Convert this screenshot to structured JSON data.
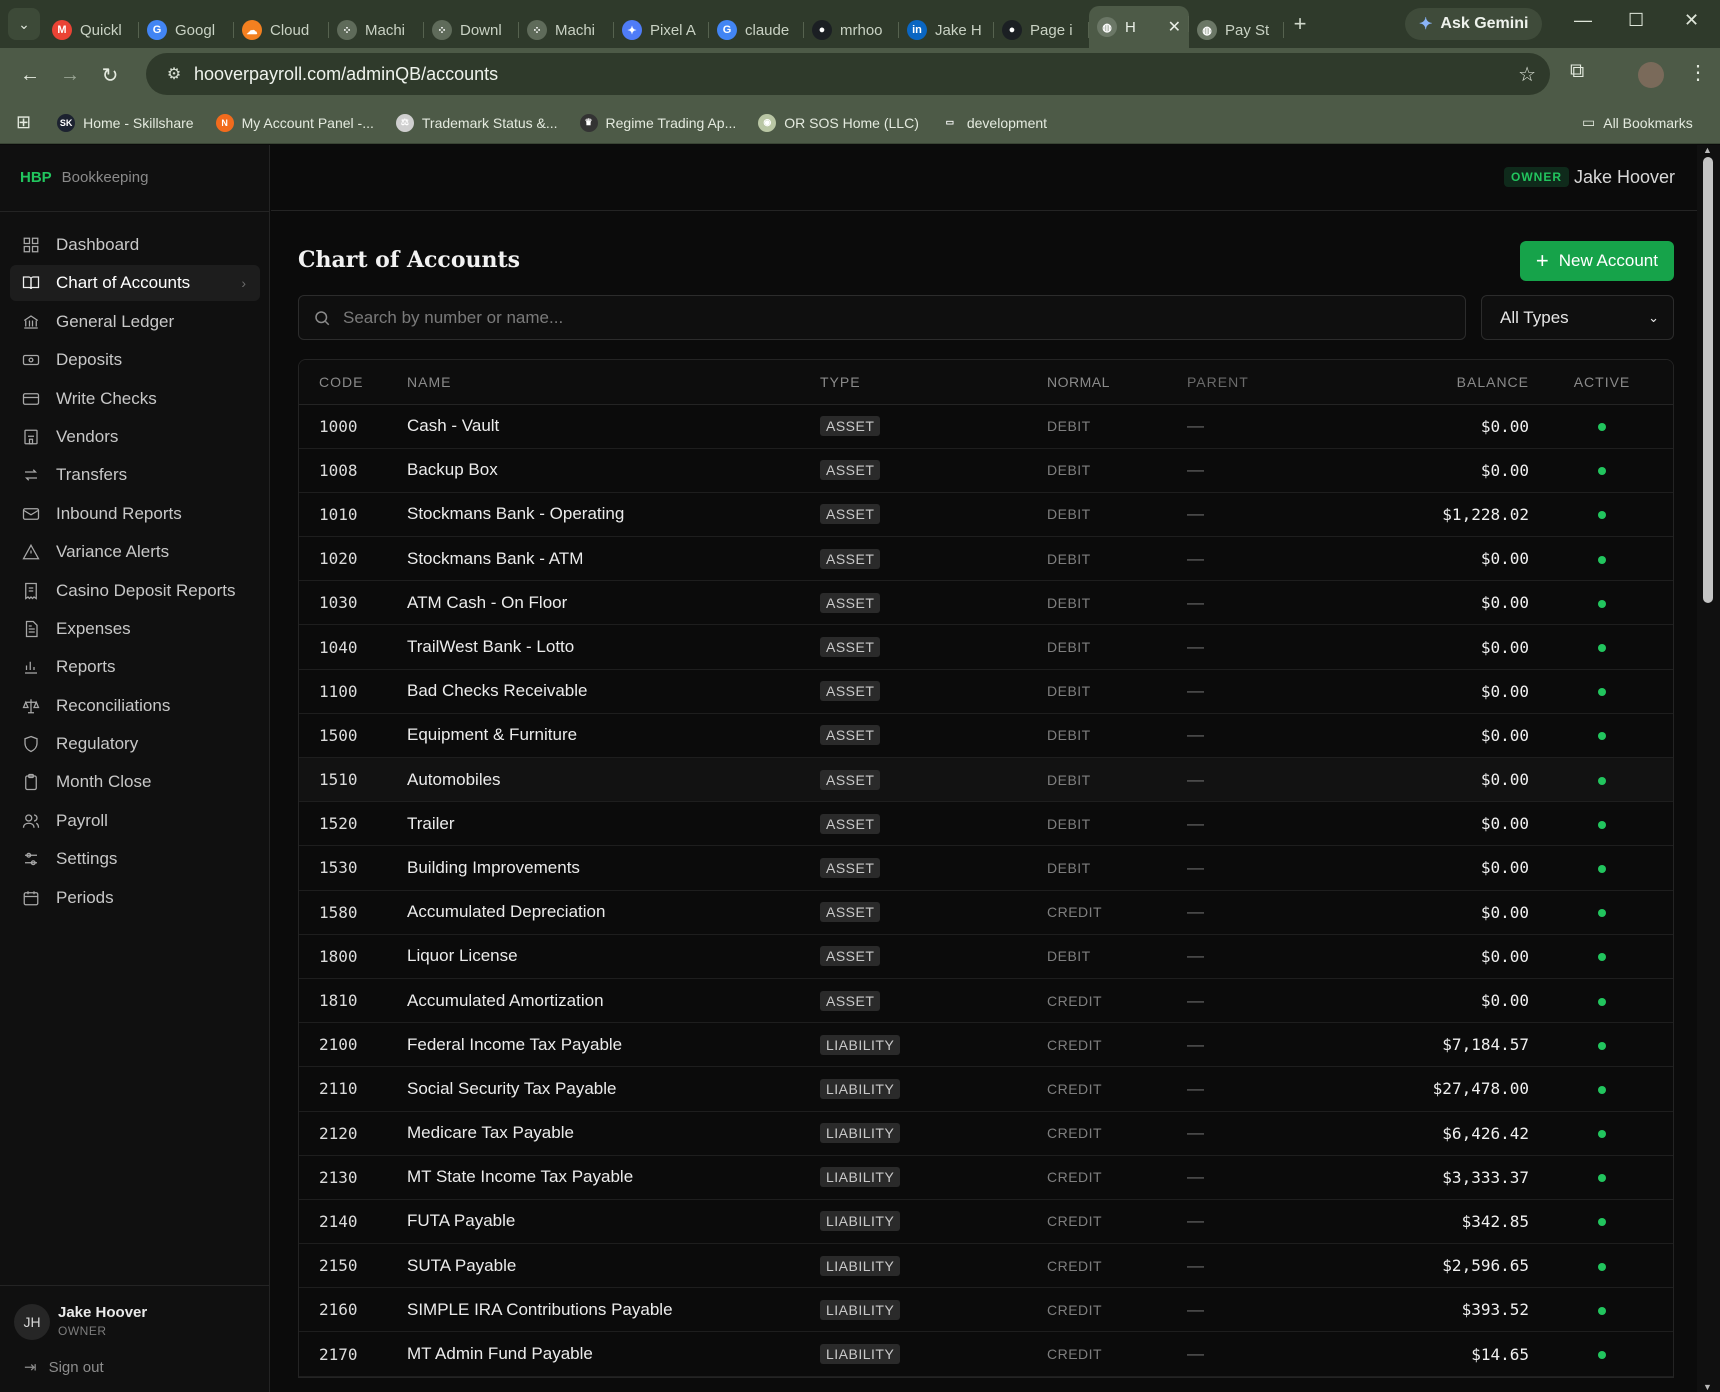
{
  "browser": {
    "tabs": [
      {
        "label": "Quickl",
        "icon": "gmail-icon",
        "color": "#ea4335",
        "glyph": "M"
      },
      {
        "label": "Googl",
        "icon": "google-icon",
        "color": "#4285f4",
        "glyph": "G"
      },
      {
        "label": "Cloud",
        "icon": "cloudflare-icon",
        "color": "#f38020",
        "glyph": "☁"
      },
      {
        "label": "Machi",
        "icon": "dots-icon",
        "color": "#5f6b5a",
        "glyph": "⁘"
      },
      {
        "label": "Downl",
        "icon": "dots-icon",
        "color": "#5f6b5a",
        "glyph": "⁘"
      },
      {
        "label": "Machi",
        "icon": "dots-icon",
        "color": "#5f6b5a",
        "glyph": "⁘"
      },
      {
        "label": "Pixel A",
        "icon": "gemini-icon",
        "color": "#4f7cf7",
        "glyph": "✦"
      },
      {
        "label": "claude",
        "icon": "google-icon",
        "color": "#4285f4",
        "glyph": "G"
      },
      {
        "label": "mrhoo",
        "icon": "github-icon",
        "color": "#1b1f23",
        "glyph": "●"
      },
      {
        "label": "Jake H",
        "icon": "linkedin-icon",
        "color": "#0a66c2",
        "glyph": "in"
      },
      {
        "label": "Page i",
        "icon": "github-icon",
        "color": "#1b1f23",
        "glyph": "●"
      },
      {
        "label": "H",
        "icon": "globe-icon",
        "color": "#6b7766",
        "glyph": "◍",
        "active": true
      },
      {
        "label": "Pay St",
        "icon": "globe-icon",
        "color": "#6b7766",
        "glyph": "◍"
      }
    ],
    "ask_gemini": "Ask Gemini",
    "url": "hooverpayroll.com/adminQB/accounts",
    "bookmarks": [
      {
        "label": "Home - Skillshare",
        "color": "#1c2230",
        "glyph": "SK"
      },
      {
        "label": "My Account Panel -...",
        "color": "#f26b1d",
        "glyph": "N"
      },
      {
        "label": "Trademark Status &...",
        "color": "#cfcfcf",
        "glyph": "⚖"
      },
      {
        "label": "Regime Trading Ap...",
        "color": "#333",
        "glyph": "♛"
      },
      {
        "label": "OR SOS Home (LLC)",
        "color": "#b9c6a4",
        "glyph": "◉"
      },
      {
        "label": "development",
        "color": "transparent",
        "glyph": "▭"
      }
    ],
    "all_bookmarks": "All Bookmarks"
  },
  "app": {
    "brand_logo": "HBP",
    "brand_name": "Bookkeeping",
    "owner_badge": "OWNER",
    "top_user": "Jake Hoover",
    "accent": "#22c55e"
  },
  "sidebar": {
    "items": [
      {
        "label": "Dashboard",
        "icon": "grid-icon"
      },
      {
        "label": "Chart of Accounts",
        "icon": "book-icon",
        "active": true
      },
      {
        "label": "General Ledger",
        "icon": "bank-icon"
      },
      {
        "label": "Deposits",
        "icon": "cash-icon"
      },
      {
        "label": "Write Checks",
        "icon": "card-icon"
      },
      {
        "label": "Vendors",
        "icon": "store-icon"
      },
      {
        "label": "Transfers",
        "icon": "transfer-icon"
      },
      {
        "label": "Inbound Reports",
        "icon": "mail-icon"
      },
      {
        "label": "Variance Alerts",
        "icon": "warning-icon"
      },
      {
        "label": "Casino Deposit Reports",
        "icon": "receipt-icon"
      },
      {
        "label": "Expenses",
        "icon": "document-icon"
      },
      {
        "label": "Reports",
        "icon": "bar-chart-icon"
      },
      {
        "label": "Reconciliations",
        "icon": "scale-icon"
      },
      {
        "label": "Regulatory",
        "icon": "shield-icon"
      },
      {
        "label": "Month Close",
        "icon": "clipboard-icon"
      },
      {
        "label": "Payroll",
        "icon": "users-icon"
      },
      {
        "label": "Settings",
        "icon": "sliders-icon"
      },
      {
        "label": "Periods",
        "icon": "calendar-icon"
      }
    ],
    "user": {
      "initials": "JH",
      "name": "Jake Hoover",
      "role": "OWNER"
    },
    "sign_out": "Sign out"
  },
  "main": {
    "title": "Chart of Accounts",
    "new_button": "New Account",
    "search_placeholder": "Search by number or name...",
    "type_filter": "All Types"
  },
  "table": {
    "columns": {
      "code": "CODE",
      "name": "NAME",
      "type": "TYPE",
      "normal": "NORMAL",
      "parent": "PARENT",
      "balance": "BALANCE",
      "active": "ACTIVE"
    },
    "rows": [
      {
        "code": "1000",
        "name": "Cash - Vault",
        "type": "ASSET",
        "normal": "DEBIT",
        "parent": "—",
        "balance": "$0.00"
      },
      {
        "code": "1008",
        "name": "Backup Box",
        "type": "ASSET",
        "normal": "DEBIT",
        "parent": "—",
        "balance": "$0.00"
      },
      {
        "code": "1010",
        "name": "Stockmans Bank - Operating",
        "type": "ASSET",
        "normal": "DEBIT",
        "parent": "—",
        "balance": "$1,228.02"
      },
      {
        "code": "1020",
        "name": "Stockmans Bank - ATM",
        "type": "ASSET",
        "normal": "DEBIT",
        "parent": "—",
        "balance": "$0.00"
      },
      {
        "code": "1030",
        "name": "ATM Cash - On Floor",
        "type": "ASSET",
        "normal": "DEBIT",
        "parent": "—",
        "balance": "$0.00"
      },
      {
        "code": "1040",
        "name": "TrailWest Bank - Lotto",
        "type": "ASSET",
        "normal": "DEBIT",
        "parent": "—",
        "balance": "$0.00"
      },
      {
        "code": "1100",
        "name": "Bad Checks Receivable",
        "type": "ASSET",
        "normal": "DEBIT",
        "parent": "—",
        "balance": "$0.00"
      },
      {
        "code": "1500",
        "name": "Equipment & Furniture",
        "type": "ASSET",
        "normal": "DEBIT",
        "parent": "—",
        "balance": "$0.00"
      },
      {
        "code": "1510",
        "name": "Automobiles",
        "type": "ASSET",
        "normal": "DEBIT",
        "parent": "—",
        "balance": "$0.00",
        "highlight": true
      },
      {
        "code": "1520",
        "name": "Trailer",
        "type": "ASSET",
        "normal": "DEBIT",
        "parent": "—",
        "balance": "$0.00"
      },
      {
        "code": "1530",
        "name": "Building Improvements",
        "type": "ASSET",
        "normal": "DEBIT",
        "parent": "—",
        "balance": "$0.00"
      },
      {
        "code": "1580",
        "name": "Accumulated Depreciation",
        "type": "ASSET",
        "normal": "CREDIT",
        "parent": "—",
        "balance": "$0.00"
      },
      {
        "code": "1800",
        "name": "Liquor License",
        "type": "ASSET",
        "normal": "DEBIT",
        "parent": "—",
        "balance": "$0.00"
      },
      {
        "code": "1810",
        "name": "Accumulated Amortization",
        "type": "ASSET",
        "normal": "CREDIT",
        "parent": "—",
        "balance": "$0.00"
      },
      {
        "code": "2100",
        "name": "Federal Income Tax Payable",
        "type": "LIABILITY",
        "normal": "CREDIT",
        "parent": "—",
        "balance": "$7,184.57"
      },
      {
        "code": "2110",
        "name": "Social Security Tax Payable",
        "type": "LIABILITY",
        "normal": "CREDIT",
        "parent": "—",
        "balance": "$27,478.00"
      },
      {
        "code": "2120",
        "name": "Medicare Tax Payable",
        "type": "LIABILITY",
        "normal": "CREDIT",
        "parent": "—",
        "balance": "$6,426.42"
      },
      {
        "code": "2130",
        "name": "MT State Income Tax Payable",
        "type": "LIABILITY",
        "normal": "CREDIT",
        "parent": "—",
        "balance": "$3,333.37"
      },
      {
        "code": "2140",
        "name": "FUTA Payable",
        "type": "LIABILITY",
        "normal": "CREDIT",
        "parent": "—",
        "balance": "$342.85"
      },
      {
        "code": "2150",
        "name": "SUTA Payable",
        "type": "LIABILITY",
        "normal": "CREDIT",
        "parent": "—",
        "balance": "$2,596.65"
      },
      {
        "code": "2160",
        "name": "SIMPLE IRA Contributions Payable",
        "type": "LIABILITY",
        "normal": "CREDIT",
        "parent": "—",
        "balance": "$393.52"
      },
      {
        "code": "2170",
        "name": "MT Admin Fund Payable",
        "type": "LIABILITY",
        "normal": "CREDIT",
        "parent": "—",
        "balance": "$14.65"
      }
    ]
  }
}
